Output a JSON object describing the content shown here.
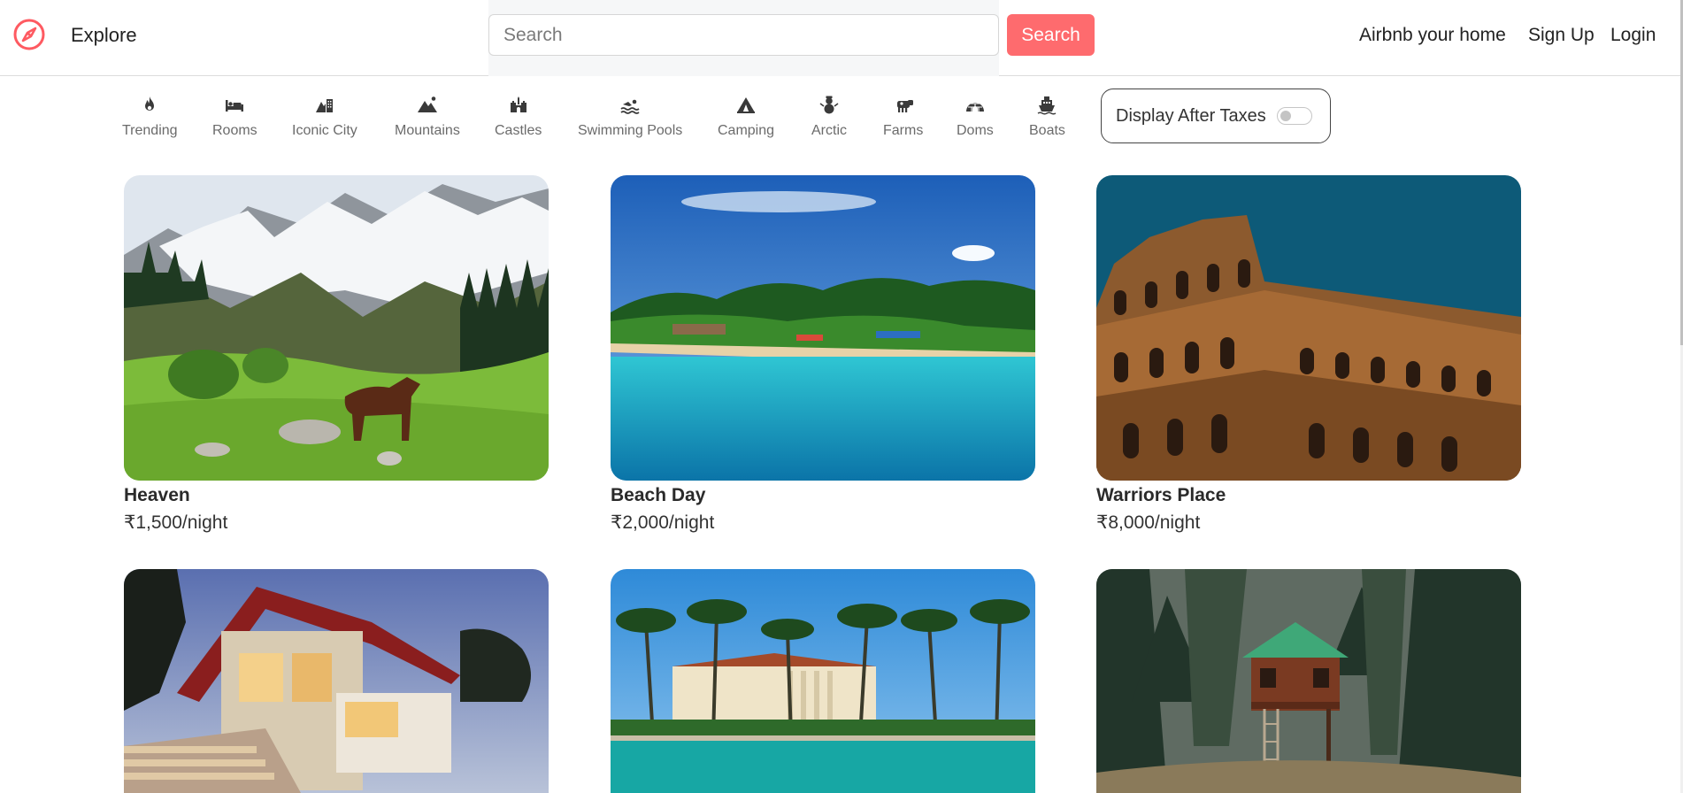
{
  "navbar": {
    "brand_icon": "compass-icon",
    "explore_label": "Explore",
    "search_placeholder": "Search",
    "search_button_label": "Search",
    "host_label": "Airbnb your home",
    "signup_label": "Sign Up",
    "login_label": "Login"
  },
  "colors": {
    "brand": "#fe5a61",
    "search_button": "#fe6b6e",
    "text": "#222222",
    "muted": "#6b6b6b"
  },
  "filters": [
    {
      "label": "Trending",
      "icon": "fire-icon"
    },
    {
      "label": "Rooms",
      "icon": "bed-icon"
    },
    {
      "label": "Iconic City",
      "icon": "city-icon"
    },
    {
      "label": "Mountains",
      "icon": "mountain-icon"
    },
    {
      "label": "Castles",
      "icon": "castle-icon"
    },
    {
      "label": "Swimming Pools",
      "icon": "swimmer-icon"
    },
    {
      "label": "Camping",
      "icon": "tent-icon"
    },
    {
      "label": "Arctic",
      "icon": "snowman-icon"
    },
    {
      "label": "Farms",
      "icon": "cow-icon"
    },
    {
      "label": "Doms",
      "icon": "igloo-icon"
    },
    {
      "label": "Boats",
      "icon": "ship-icon"
    }
  ],
  "tax_toggle": {
    "label": "Display After Taxes",
    "enabled": false
  },
  "listings": [
    {
      "title": "Heaven",
      "price": "₹1,500/night",
      "image": "mountain-meadow-horse-photo"
    },
    {
      "title": "Beach Day",
      "price": "₹2,000/night",
      "image": "tropical-beach-photo"
    },
    {
      "title": "Warriors Place",
      "price": "₹8,000/night",
      "image": "colosseum-photo"
    },
    {
      "title": "",
      "price": "",
      "image": "modern-villa-photo"
    },
    {
      "title": "",
      "price": "",
      "image": "palm-mansion-photo"
    },
    {
      "title": "",
      "price": "",
      "image": "treehouse-forest-photo"
    }
  ]
}
